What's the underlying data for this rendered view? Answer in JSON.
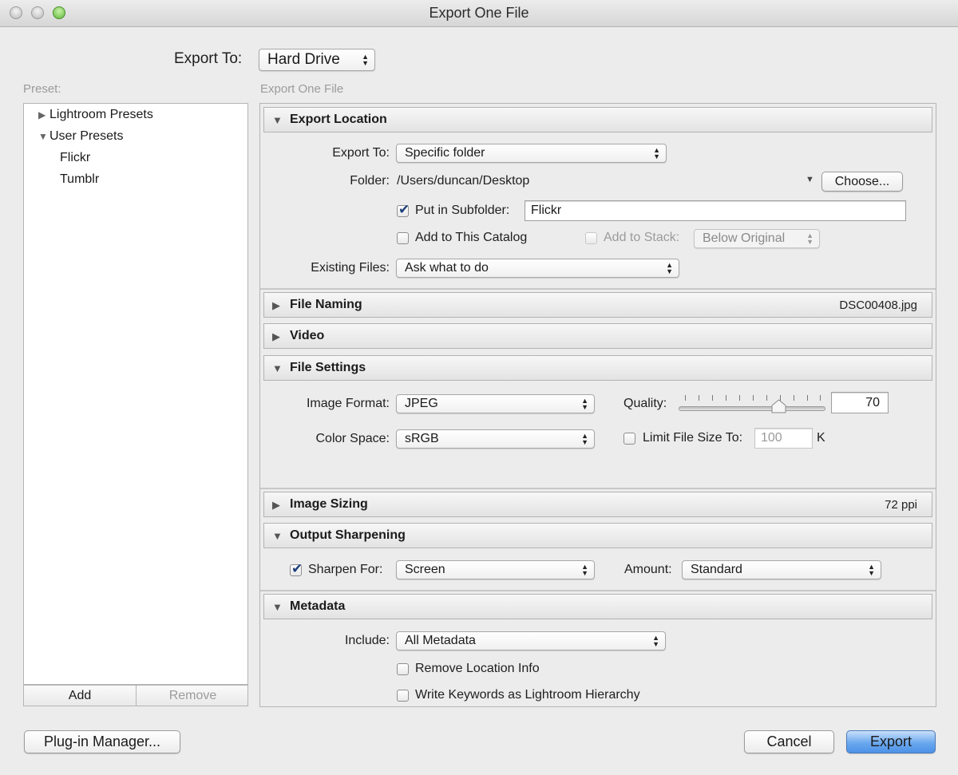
{
  "window": {
    "title": "Export One File"
  },
  "top": {
    "export_to_label": "Export To:",
    "export_to_value": "Hard Drive"
  },
  "presets": {
    "label": "Preset:",
    "items": [
      "Lightroom Presets",
      "User Presets",
      "Flickr",
      "Tumblr"
    ],
    "add_label": "Add",
    "remove_label": "Remove"
  },
  "panel": {
    "heading": "Export One File",
    "export_location": {
      "title": "Export Location",
      "export_to_label": "Export To:",
      "export_to_value": "Specific folder",
      "folder_label": "Folder:",
      "folder_value": "/Users/duncan/Desktop",
      "choose_label": "Choose...",
      "subfolder_label": "Put in Subfolder:",
      "subfolder_checked": true,
      "subfolder_value": "Flickr",
      "add_catalog_label": "Add to This Catalog",
      "add_stack_label": "Add to Stack:",
      "stack_value": "Below Original",
      "existing_label": "Existing Files:",
      "existing_value": "Ask what to do"
    },
    "file_naming": {
      "title": "File Naming",
      "summary": "DSC00408.jpg"
    },
    "video": {
      "title": "Video"
    },
    "file_settings": {
      "title": "File Settings",
      "format_label": "Image Format:",
      "format_value": "JPEG",
      "quality_label": "Quality:",
      "quality_value": "70",
      "colorspace_label": "Color Space:",
      "colorspace_value": "sRGB",
      "limit_label": "Limit File Size To:",
      "limit_value": "100",
      "limit_unit": "K"
    },
    "image_sizing": {
      "title": "Image Sizing",
      "summary": "72 ppi"
    },
    "output_sharpening": {
      "title": "Output Sharpening",
      "sharpen_label": "Sharpen For:",
      "sharpen_checked": true,
      "sharpen_value": "Screen",
      "amount_label": "Amount:",
      "amount_value": "Standard"
    },
    "metadata": {
      "title": "Metadata",
      "include_label": "Include:",
      "include_value": "All Metadata",
      "remove_location_label": "Remove Location Info",
      "write_keywords_label": "Write Keywords as Lightroom Hierarchy"
    }
  },
  "footer": {
    "plugin_label": "Plug-in Manager...",
    "cancel_label": "Cancel",
    "export_label": "Export"
  },
  "icons": {
    "expanded": "disclosure-triangle-down",
    "collapsed": "disclosure-triangle-right",
    "popup": "up-down-arrows",
    "check": "checkmark"
  }
}
